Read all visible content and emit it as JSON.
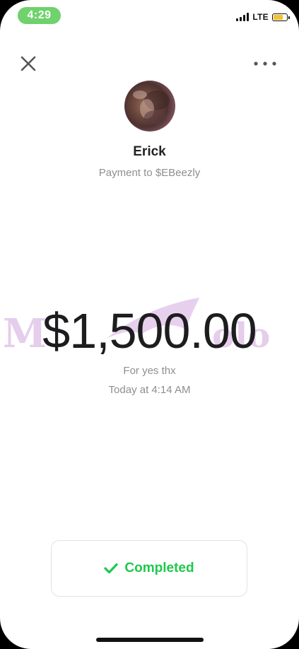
{
  "status_bar": {
    "time": "4:29",
    "network": "LTE",
    "time_pill_color": "#6fd26c",
    "battery_color": "#f2c230",
    "battery_level": 0.7
  },
  "header": {
    "close_icon": "close-icon",
    "more_icon": "more-horizontal-icon"
  },
  "recipient": {
    "name": "Erick",
    "subtitle": "Payment to $EBeezly"
  },
  "payment": {
    "amount": "$1,500.00",
    "note": "For yes thx",
    "date": "Today at 4:14 AM"
  },
  "watermark": {
    "text": "Marco Polo",
    "color": "#e3c8ea"
  },
  "status": {
    "label": "Completed",
    "icon": "checkmark-icon",
    "color": "#1ec84c"
  }
}
